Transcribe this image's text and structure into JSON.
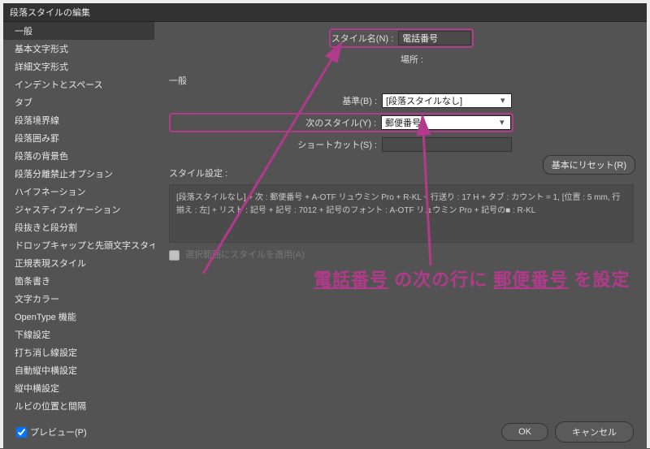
{
  "title": "段落スタイルの編集",
  "sidebar": {
    "items": [
      {
        "label": "一般"
      },
      {
        "label": "基本文字形式"
      },
      {
        "label": "詳細文字形式"
      },
      {
        "label": "インデントとスペース"
      },
      {
        "label": "タブ"
      },
      {
        "label": "段落境界線"
      },
      {
        "label": "段落囲み罫"
      },
      {
        "label": "段落の背景色"
      },
      {
        "label": "段落分離禁止オプション"
      },
      {
        "label": "ハイフネーション"
      },
      {
        "label": "ジャスティフィケーション"
      },
      {
        "label": "段抜きと段分割"
      },
      {
        "label": "ドロップキャップと先頭文字スタイル"
      },
      {
        "label": "正規表現スタイル"
      },
      {
        "label": "箇条書き"
      },
      {
        "label": "文字カラー"
      },
      {
        "label": "OpenType 機能"
      },
      {
        "label": "下線設定"
      },
      {
        "label": "打ち消し線設定"
      },
      {
        "label": "自動縦中横設定"
      },
      {
        "label": "縦中横設定"
      },
      {
        "label": "ルビの位置と間隔"
      }
    ]
  },
  "main": {
    "section": "一般",
    "styleName": {
      "label": "スタイル名(N) :",
      "value": "電話番号"
    },
    "location": {
      "label": "場所 :"
    },
    "base": {
      "label": "基準(B) :",
      "value": "[段落スタイルなし]"
    },
    "next": {
      "label": "次のスタイル(Y) :",
      "value": "郵便番号"
    },
    "shortcut": {
      "label": "ショートカット(S) :"
    },
    "settings": {
      "label": "スタイル設定 :",
      "text": "[段落スタイルなし] + 次 : 郵便番号 + A-OTF リュウミン Pro + R-KL + 行送り : 17 H + タブ : カウント = 1, [位置 : 5 mm, 行揃え : 左] + リスト : 記号 + 記号 : 7012 + 記号のフォント : A-OTF リュウミン Pro + 記号の■ : R-KL"
    },
    "reset": "基本にリセット(R)",
    "applyToSel": "選択範囲にスタイルを適用(A)"
  },
  "footer": {
    "preview": "プレビュー(P)",
    "ok": "OK",
    "cancel": "キャンセル"
  },
  "annotation": {
    "t1": "電話番号",
    "t2": " の次の行に ",
    "t3": "郵便番号",
    "t4": " を設定"
  }
}
